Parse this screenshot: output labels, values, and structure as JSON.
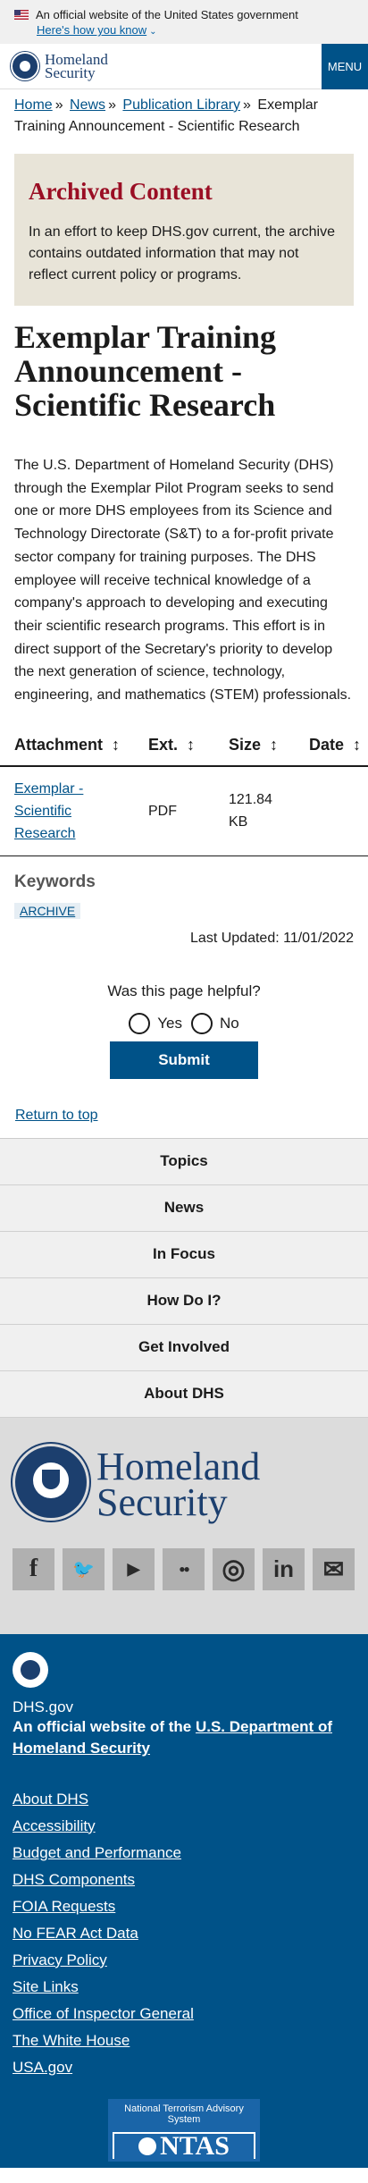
{
  "gov_banner": {
    "text": "An official website of the United States government",
    "link": "Here's how you know"
  },
  "header": {
    "logo_line1": "Homeland",
    "logo_line2": "Security",
    "menu": "MENU"
  },
  "breadcrumb": {
    "items": [
      "Home",
      "News",
      "Publication Library"
    ],
    "current": "Exemplar Training Announcement - Scientific Research"
  },
  "archived": {
    "title": "Archived Content",
    "text": "In an effort to keep DHS.gov current, the archive contains outdated information that may not reflect current policy or programs."
  },
  "page": {
    "title": "Exemplar Training Announcement - Scientific Research",
    "body": "The U.S. Department of Homeland Security (DHS) through the Exemplar Pilot Program seeks to send one or more DHS employees from its Science and Technology Directorate (S&T) to a for-profit private sector company for training purposes. The DHS employee will receive technical knowledge of a company's approach to developing and executing their scientific research programs. This effort is in direct support of the Secretary's priority to develop the next generation of science, technology, engineering, and mathematics (STEM) professionals."
  },
  "table": {
    "headers": [
      "Attachment",
      "Ext.",
      "Size",
      "Date"
    ],
    "sort_icon": "↕",
    "rows": [
      {
        "attachment": "Exemplar - Scientific Research",
        "ext": "PDF",
        "size": "121.84 KB",
        "date": ""
      }
    ]
  },
  "keywords": {
    "title": "Keywords",
    "tags": [
      "ARCHIVE"
    ]
  },
  "last_updated": "Last Updated: 11/01/2022",
  "feedback": {
    "question": "Was this page helpful?",
    "yes": "Yes",
    "no": "No",
    "submit": "Submit"
  },
  "return_to_top": "Return to top",
  "footer_nav": [
    "Topics",
    "News",
    "In Focus",
    "How Do I?",
    "Get Involved",
    "About DHS"
  ],
  "footer_logo": {
    "line1": "Homeland",
    "line2": "Security"
  },
  "social": [
    {
      "icon": "facebook-icon",
      "glyph": "f"
    },
    {
      "icon": "twitter-icon",
      "glyph": "🐦"
    },
    {
      "icon": "youtube-icon",
      "glyph": "▶"
    },
    {
      "icon": "flickr-icon",
      "glyph": "●●"
    },
    {
      "icon": "instagram-icon",
      "glyph": "◎"
    },
    {
      "icon": "linkedin-icon",
      "glyph": "in"
    },
    {
      "icon": "email-icon",
      "glyph": "✉"
    }
  ],
  "bottom_footer": {
    "site": "DHS.gov",
    "official_prefix": "An official website of the ",
    "official_link": "U.S. Department of Homeland Security",
    "links": [
      "About DHS",
      "Accessibility",
      "Budget and Performance",
      "DHS Components",
      "FOIA Requests",
      "No FEAR Act Data",
      "Privacy Policy",
      "Site Links",
      "Office of Inspector General",
      "The White House",
      "USA.gov"
    ],
    "ntas_label": "National Terrorism Advisory System",
    "ntas_big": "NTAS"
  },
  "colors": {
    "primary": "#005288",
    "archived_title": "#9a0e24",
    "archived_bg": "#e8e4d8"
  }
}
